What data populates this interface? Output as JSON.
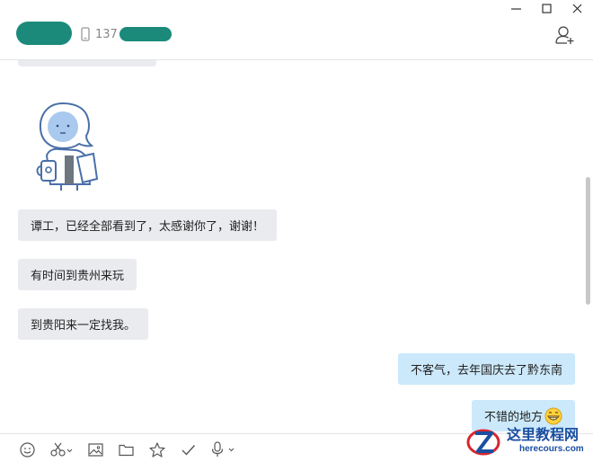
{
  "header": {
    "phone_prefix": "137",
    "window_controls": [
      "minimize-icon",
      "maximize-icon",
      "close-icon"
    ],
    "add_friend_icon": "add-user-icon",
    "mask_color": "#1b8a7a"
  },
  "messages": [
    {
      "side": "in",
      "text": "谭工，已经全部看到了，太感谢你了，谢谢！"
    },
    {
      "side": "in",
      "text": "有时间到贵州来玩"
    },
    {
      "side": "in",
      "text": "到贵阳来一定找我。"
    },
    {
      "side": "out",
      "text": "不客气，去年国庆去了黔东南"
    },
    {
      "side": "out",
      "text": "不错的地方",
      "emoji": "grin-emoji"
    }
  ],
  "toolbar": {
    "icons": [
      "emoji-icon",
      "scissors-icon",
      "image-icon",
      "folder-icon",
      "star-icon",
      "check-icon",
      "microphone-icon"
    ]
  },
  "watermark": {
    "title": "这里教程网",
    "subtitle": "herecours.com"
  },
  "colors": {
    "incoming_bubble": "#e9ebee",
    "outgoing_bubble": "#cce9fb",
    "watermark": "#1a4fa0"
  }
}
